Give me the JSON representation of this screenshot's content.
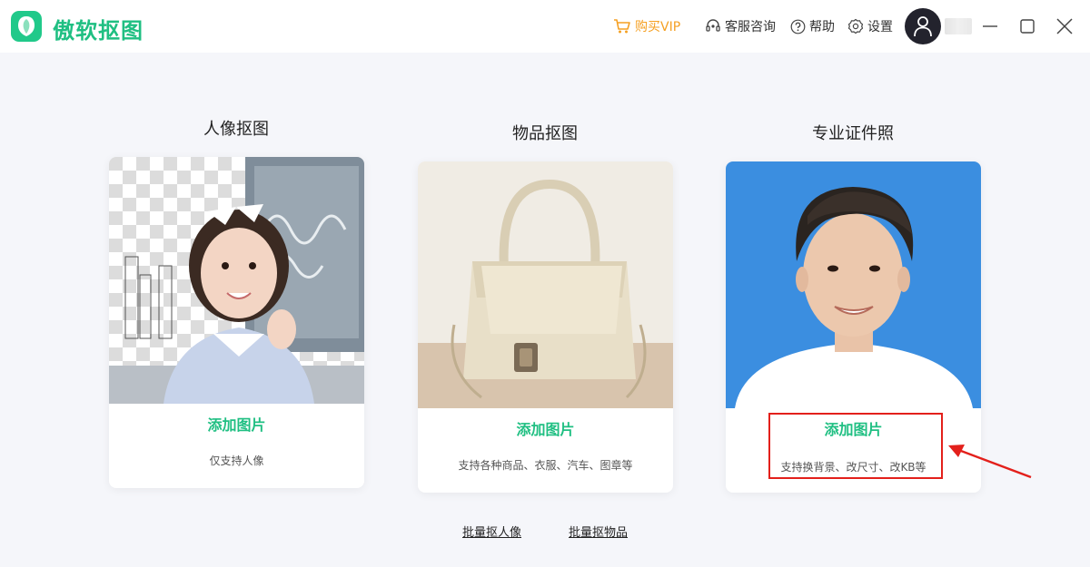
{
  "app": {
    "title": "傲软抠图"
  },
  "toolbar": {
    "vip_label": "购买VIP",
    "service_label": "客服咨询",
    "help_label": "帮助",
    "settings_label": "设置"
  },
  "cards": [
    {
      "title": "人像抠图",
      "action": "添加图片",
      "desc": "仅支持人像"
    },
    {
      "title": "物品抠图",
      "action": "添加图片",
      "desc": "支持各种商品、衣服、汽车、图章等"
    },
    {
      "title": "专业证件照",
      "action": "添加图片",
      "desc": "支持换背景、改尺寸、改KB等"
    }
  ],
  "batch": {
    "portrait": "批量抠人像",
    "object": "批量抠物品"
  },
  "colors": {
    "brand": "#1fbf82",
    "vip": "#f5a023",
    "highlight": "#e3201b",
    "id_photo_bg": "#3b8ee0"
  }
}
